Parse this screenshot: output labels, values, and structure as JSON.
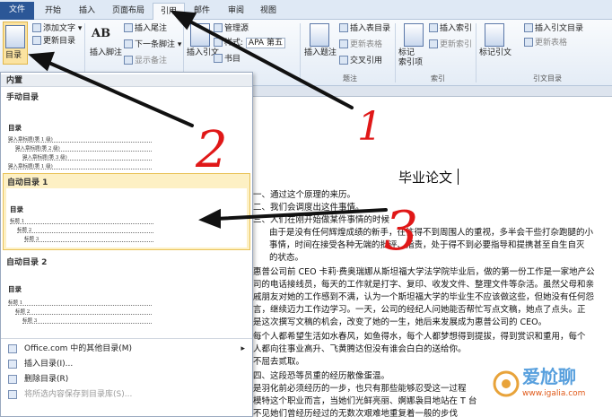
{
  "tabs": [
    "文件",
    "开始",
    "插入",
    "页面布局",
    "引用",
    "邮件",
    "审阅",
    "视图"
  ],
  "ribbon": {
    "toc_button": "目录",
    "add_text": "添加文字",
    "update_toc": "更新目录",
    "ab_label": "AB",
    "insert_footnote": "插入脚注",
    "insert_endnote": "插入尾注",
    "next_footnote": "下一条脚注",
    "show_notes": "显示备注",
    "insert_citation": "插入引文",
    "manage_sources": "管理源",
    "style_label": "样式:",
    "style_value": "APA 第五",
    "bibliography": "书目",
    "insert_caption": "插入题注",
    "insert_table_of_figures": "插入表目录",
    "update_table": "更新表格",
    "cross_reference": "交叉引用",
    "mark_entry": "标记\n索引项",
    "insert_index": "插入索引",
    "update_index": "更新索引",
    "mark_citation": "标记引文",
    "insert_toa": "插入引文目录",
    "update_toa": "更新表格",
    "group_caption": "题注",
    "group_index": "索引",
    "group_toa": "引文目录"
  },
  "dropdown": {
    "builtin": "内置",
    "manual_title": "手动目录",
    "auto1_title": "自动目录 1",
    "auto2_title": "自动目录 2",
    "toc_label": "目录",
    "manual_lines": [
      "键入章标题(第 1 级)",
      "键入章标题(第 2 级)",
      "键入章标题(第 3 级)",
      "键入章标题(第 1 级)"
    ],
    "auto_lines": [
      "标题 1",
      "标题 2",
      "标题 3"
    ],
    "menu": [
      "Office.com 中的其他目录(M)",
      "插入目录(I)...",
      "删除目录(R)",
      "将所选内容保存到目录库(S)..."
    ]
  },
  "document": {
    "title": "毕业论文",
    "lines": [
      "一、通过这个原理的来历。",
      "二、我们会调度出这件事情。",
      "三、人们在刚开始做某件事情的时候",
      "由于是没有任何辉煌成绩的新手，往往得不到周围人的重视，多半会干些打杂跑腿的小",
      "事情，时间在接受各种无端的批评、指责，处于得不到必要指导和提携甚至自生自灭",
      "的状态。",
      "惠普公司前 CEO 卡莉·费奥瑞娜从斯坦福大学法学院毕业后，做的第一份工作是一家地产公",
      "司的电话接线员，每天的工作就是打字、复印、收发文件、整理文件等杂活。虽然父母和亲",
      "戚朋友对她的工作感到不满，认为一个斯坦福大学的毕业生不应该做这些，但她没有任何怨",
      "言，继续迈力工作边学习。一天，公司的经纪人问她能否帮忙写点文稿，她点了点头。正",
      "是这次撰写文稿的机会，改变了她的一生，她后来发展成为惠普公司的 CEO。",
      "每个人都希望生活如水春风，如鱼得水，每个人都梦想得到提拔，得到赏识和重用，每个",
      "人都向往事业高升、飞黄腾达但没有谁会白白的送给你。",
      "不屈去贰取。",
      "四、这段恐等员重的经历散像蛋温。",
      "是羽化前必须经历的一步，也只有那些能够忍受这一过程",
      "模特这个职业而言，当她们光鲜亮丽、婀娜袅目地站在 T 台",
      "不见她们曾经历经过的无数次艰难地重复着一般的步伐"
    ]
  },
  "annotations": [
    "1",
    "2",
    "3"
  ],
  "watermark": {
    "brand": "爱尬聊",
    "url": "www.igalia.com"
  },
  "colors": {
    "file_tab": "#2b5797",
    "selected_item": "#fdf0c4",
    "annotation_red": "#e01818",
    "ribbon_bg": "#e4ecf6"
  }
}
